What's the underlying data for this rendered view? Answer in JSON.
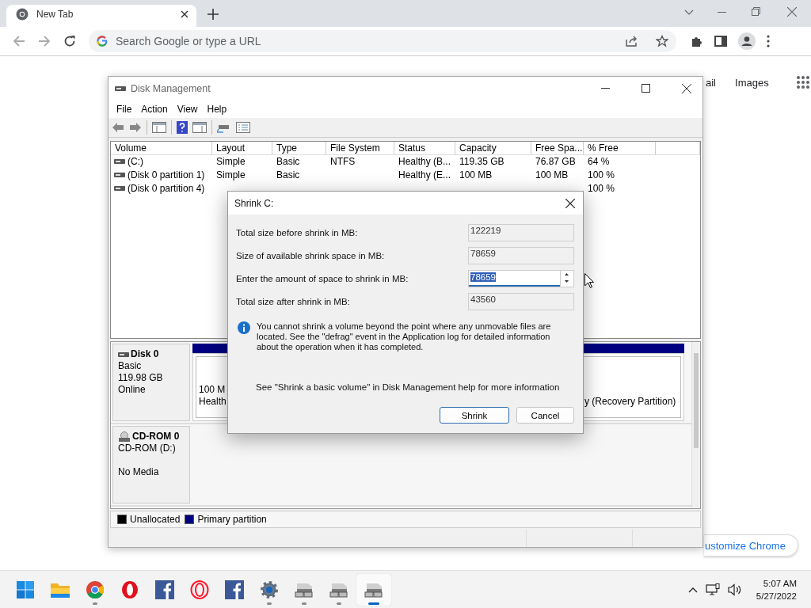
{
  "browser": {
    "tab": {
      "title": "New Tab",
      "selected": true
    },
    "omnibox": {
      "placeholder": "Search Google or type a URL"
    }
  },
  "new_tab_page": {
    "links": [
      "ail",
      "Images"
    ],
    "customize_button": "ustomize Chrome"
  },
  "disk_management": {
    "title": "Disk Management",
    "menu": [
      "File",
      "Action",
      "View",
      "Help"
    ],
    "volume_table": {
      "columns": [
        "Volume",
        "Layout",
        "Type",
        "File System",
        "Status",
        "Capacity",
        "Free Spa...",
        "% Free"
      ],
      "rows": [
        [
          "(C:)",
          "Simple",
          "Basic",
          "NTFS",
          "Healthy (B...",
          "119.35 GB",
          "76.87 GB",
          "64 %"
        ],
        [
          "(Disk 0 partition 1)",
          "Simple",
          "Basic",
          null,
          "Healthy (E...",
          "100 MB",
          "100 MB",
          "100 %"
        ],
        [
          "(Disk 0 partition 4)",
          null,
          null,
          null,
          null,
          null,
          null,
          "100 %"
        ]
      ]
    },
    "disks": [
      {
        "kind": "disk",
        "name": "Disk 0",
        "lines": [
          "Basic",
          "119.98 GB",
          "Online"
        ],
        "partitions": [
          {
            "lines": [
              "100 M",
              "Health"
            ]
          },
          {
            "lines": [
              "y (Recovery Partition)"
            ]
          }
        ]
      },
      {
        "kind": "cdrom",
        "name": "CD-ROM 0",
        "lines": [
          "CD-ROM (D:)",
          "No Media"
        ]
      }
    ],
    "legend": [
      {
        "label": "Unallocated",
        "color": "#000000"
      },
      {
        "label": "Primary partition",
        "color": "#000080"
      }
    ]
  },
  "dialog": {
    "title": "Shrink C:",
    "fields": [
      {
        "kind": "readonly",
        "label": "Total size before shrink in MB:",
        "value": "122219"
      },
      {
        "kind": "readonly",
        "label": "Size of available shrink space in MB:",
        "value": "78659"
      },
      {
        "kind": "spin",
        "label": "Enter the amount of space to shrink in MB:",
        "value": "78659",
        "selected": true
      },
      {
        "kind": "readonly",
        "label": "Total size after shrink in MB:",
        "value": "43560"
      }
    ],
    "info": "You cannot shrink a volume beyond the point where any unmovable files are located. See the \"defrag\" event in the Application log for detailed information about the operation when it has completed.",
    "help": "See \"Shrink a basic volume\" in Disk Management help for more information",
    "buttons": [
      {
        "label": "Shrink",
        "default": true
      },
      {
        "label": "Cancel",
        "default": false
      }
    ]
  },
  "taskbar": {
    "apps": [
      {
        "kind": "start",
        "running": false,
        "active": false
      },
      {
        "kind": "folder",
        "running": false,
        "active": false
      },
      {
        "kind": "ball",
        "running": true,
        "active": false
      },
      {
        "kind": "ring",
        "running": false,
        "active": false
      },
      {
        "kind": "square",
        "running": false,
        "active": false
      },
      {
        "kind": "thin-ring",
        "running": false,
        "active": false
      },
      {
        "kind": "square",
        "running": false,
        "active": false
      },
      {
        "kind": "gear",
        "running": true,
        "active": false
      },
      {
        "kind": "drive",
        "running": true,
        "active": false
      },
      {
        "kind": "drive",
        "running": true,
        "active": false
      },
      {
        "kind": "drive",
        "running": true,
        "active": true
      }
    ],
    "time": "5:07 AM",
    "date": "5/27/2022"
  }
}
